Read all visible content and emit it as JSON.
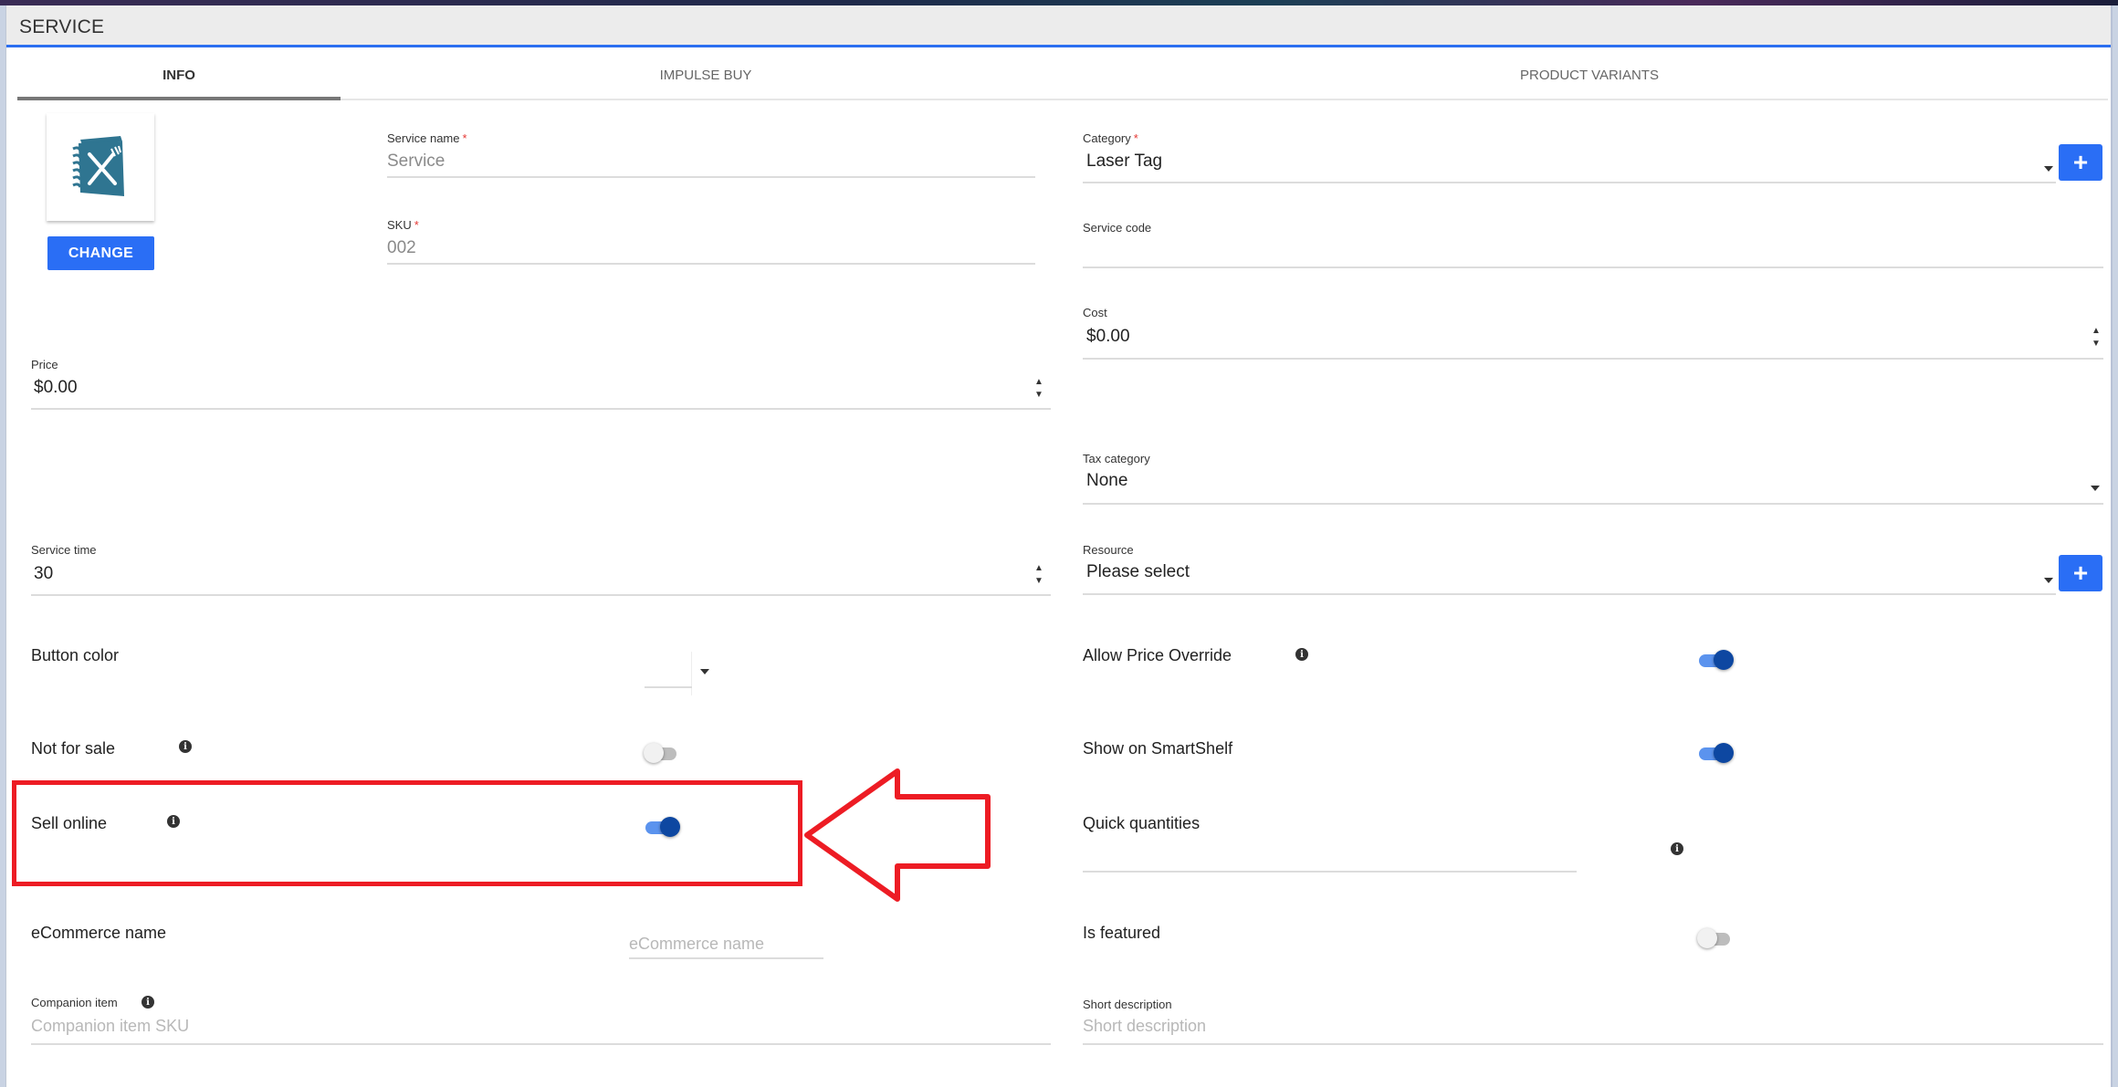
{
  "window": {
    "title": "SERVICE"
  },
  "tabs": [
    {
      "label": "INFO",
      "active": true
    },
    {
      "label": "IMPULSE BUY",
      "active": false
    },
    {
      "label": "PRODUCT VARIANTS",
      "active": false
    }
  ],
  "image": {
    "icon": "menu-book-icon",
    "change_label": "CHANGE"
  },
  "fields": {
    "service_name": {
      "label": "Service name",
      "required": "*",
      "value": "Service"
    },
    "sku": {
      "label": "SKU",
      "required": "*",
      "value": "002"
    },
    "category": {
      "label": "Category",
      "required": "*",
      "value": "Laser Tag",
      "add_label": "+"
    },
    "service_code": {
      "label": "Service code",
      "value": ""
    },
    "cost": {
      "label": "Cost",
      "value": "$0.00"
    },
    "price": {
      "label": "Price",
      "value": "$0.00"
    },
    "tax_category": {
      "label": "Tax category",
      "value": "None"
    },
    "service_time": {
      "label": "Service time",
      "value": "30"
    },
    "resource": {
      "label": "Resource",
      "value": "Please select",
      "add_label": "+"
    },
    "button_color": {
      "label": "Button color"
    },
    "allow_price_override": {
      "label": "Allow Price Override",
      "on": true
    },
    "not_for_sale": {
      "label": "Not for sale",
      "on": false
    },
    "show_on_smartshelf": {
      "label": "Show on SmartShelf",
      "on": true
    },
    "sell_online": {
      "label": "Sell online",
      "on": true
    },
    "quick_quantities": {
      "label": "Quick quantities",
      "value": ""
    },
    "ecommerce_name": {
      "label": "eCommerce name",
      "placeholder": "eCommerce name"
    },
    "is_featured": {
      "label": "Is featured",
      "on": false
    },
    "companion_item": {
      "label": "Companion item",
      "placeholder": "Companion item SKU"
    },
    "short_description": {
      "label": "Short description",
      "placeholder": "Short description"
    }
  },
  "glyphs": {
    "info": "i",
    "spin_up": "▲",
    "spin_down": "▼"
  },
  "annotation": {
    "color": "#ed1c24",
    "highlighted": "sell_online"
  },
  "colors": {
    "accent": "#2a6ef5",
    "toggle_on": "#0d47a1",
    "toggle_track_on": "#5b93ee"
  }
}
